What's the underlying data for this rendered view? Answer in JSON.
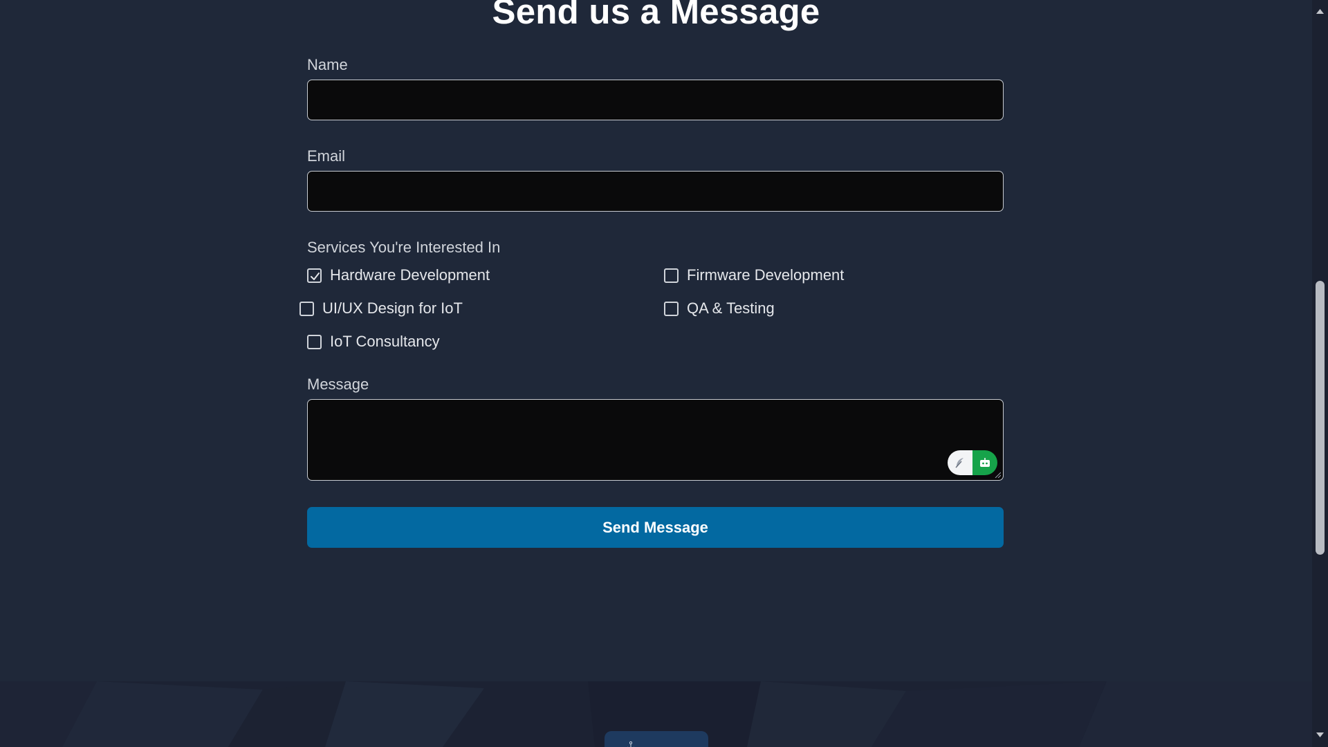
{
  "header": {
    "title": "Send us a Message"
  },
  "form": {
    "name_label": "Name",
    "name_value": "",
    "email_label": "Email",
    "email_value": "",
    "services_label": "Services You're Interested In",
    "services": [
      {
        "label": "Hardware Development",
        "checked": true
      },
      {
        "label": "Firmware Development",
        "checked": false
      },
      {
        "label": "UI/UX Design for IoT",
        "checked": false
      },
      {
        "label": "QA & Testing",
        "checked": false
      },
      {
        "label": "IoT Consultancy",
        "checked": false
      }
    ],
    "message_label": "Message",
    "message_value": "",
    "submit_label": "Send Message"
  },
  "widgets": {
    "left_icon": "feather-icon",
    "right_icon": "robot-icon",
    "right_color": "#16a34a"
  },
  "colors": {
    "background": "#1f2839",
    "accent": "#0369a1",
    "input_bg": "#0a0a0b"
  },
  "footer": {
    "icon": "anchor-icon"
  }
}
